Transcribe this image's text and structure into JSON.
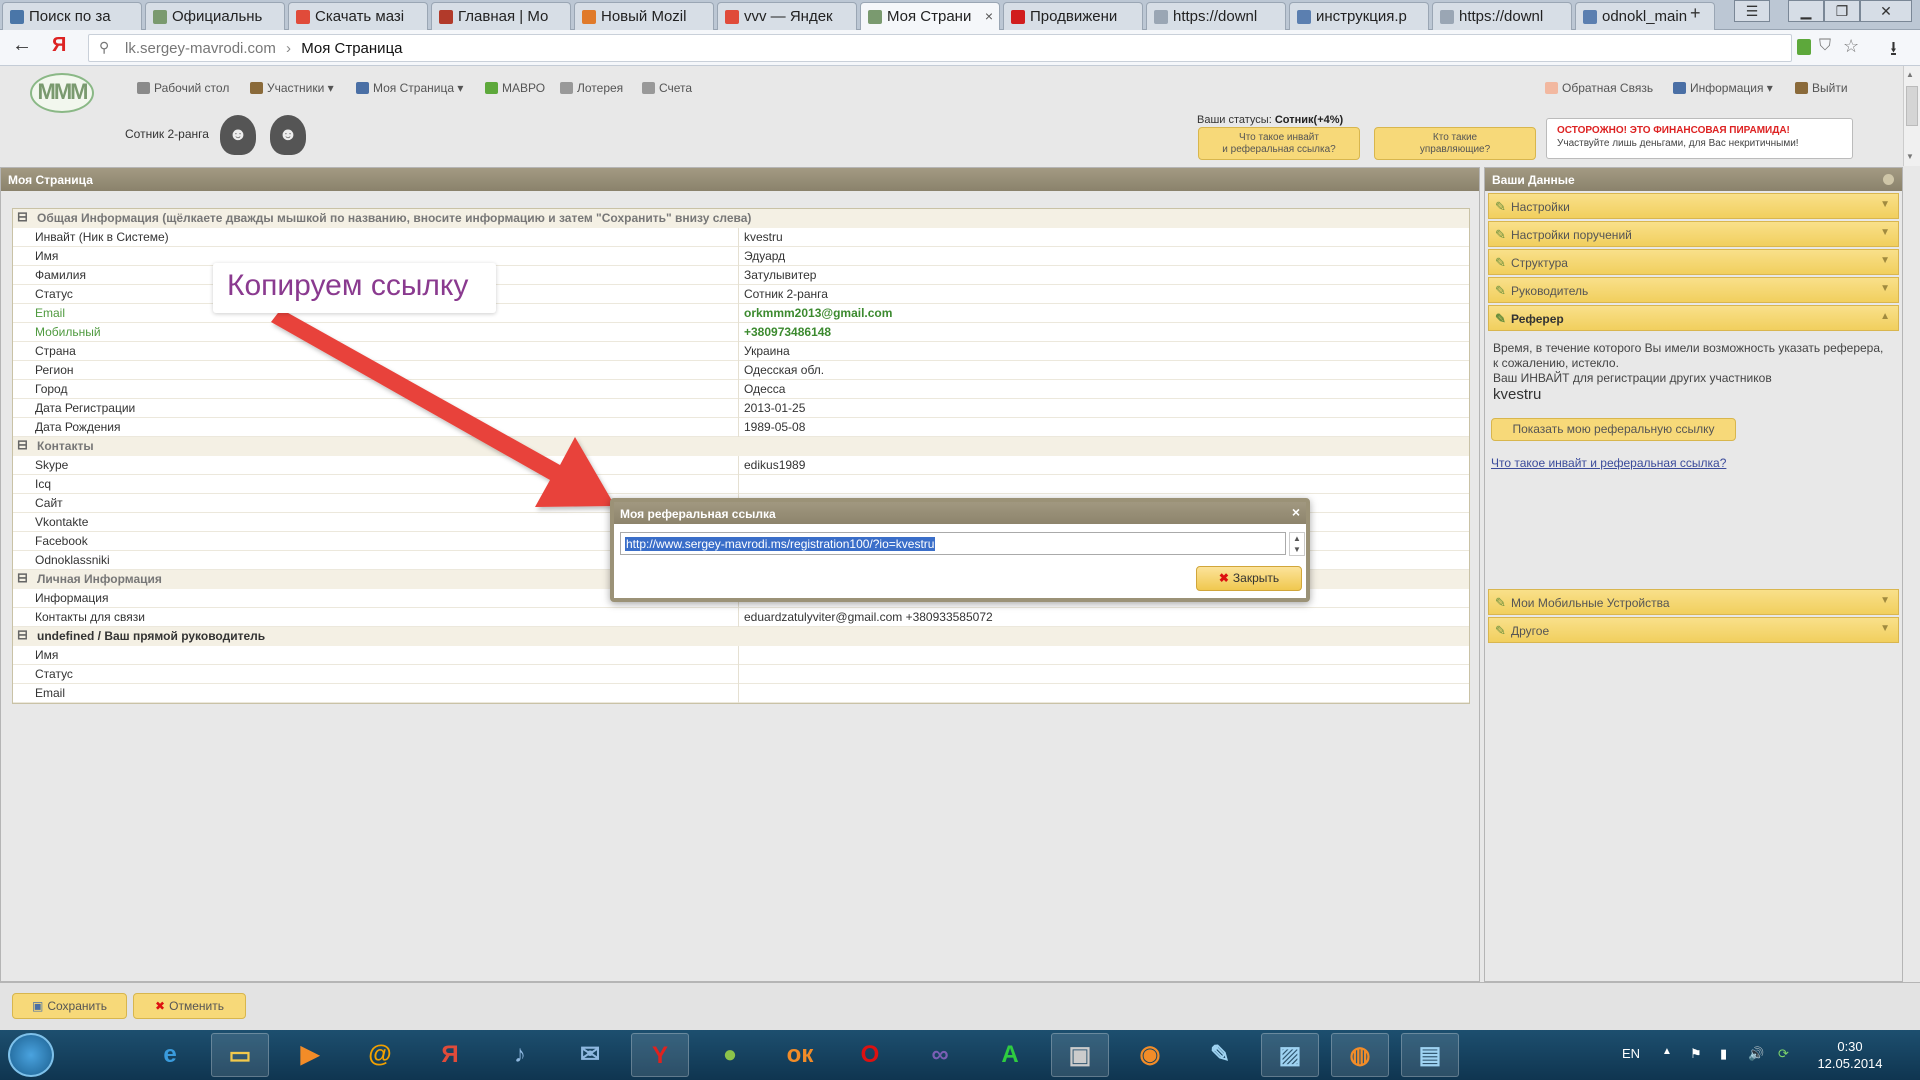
{
  "browser": {
    "tabs": [
      {
        "label": "Поиск по за",
        "color": "#4a76a8"
      },
      {
        "label": "Официальнь",
        "color": "#7a9a6f"
      },
      {
        "label": "Скачать мазі",
        "color": "#e04b3a"
      },
      {
        "label": "Главная | Мо",
        "color": "#b23a2a"
      },
      {
        "label": "Новый Mozil",
        "color": "#e07a2a"
      },
      {
        "label": "vvv — Яндек",
        "color": "#e04b3a"
      },
      {
        "label": "Моя Страни",
        "color": "#7a9a6f",
        "active": true
      },
      {
        "label": "Продвижени",
        "color": "#d11d1d"
      },
      {
        "label": "https://downl",
        "color": "#9aa6b4"
      },
      {
        "label": "инструкция.р",
        "color": "#5b7fb0"
      },
      {
        "label": "https://downl",
        "color": "#9aa6b4"
      },
      {
        "label": "odnokl_main",
        "color": "#5b7fb0"
      }
    ],
    "new_tab": "+",
    "yandex_logo": "Я",
    "url_domain": "lk.sergey-mavrodi.com",
    "url_sep": "›",
    "url_title": "Моя Страница",
    "accent": "#7a9a6f"
  },
  "site": {
    "logo": "MMM",
    "nav": [
      {
        "label": "Рабочий стол",
        "icon": "desktop-icon"
      },
      {
        "label": "Участники ▾",
        "icon": "users-icon"
      },
      {
        "label": "Моя Страница ▾",
        "icon": "user-icon"
      },
      {
        "label": "МАВРО",
        "icon": "mavro-icon"
      },
      {
        "label": "Лотерея",
        "icon": "lottery-icon"
      },
      {
        "label": "Счета",
        "icon": "accounts-icon"
      }
    ],
    "nav_right": [
      {
        "label": "Обратная Связь",
        "icon": "feedback-icon"
      },
      {
        "label": "Информация ▾",
        "icon": "info-icon"
      },
      {
        "label": "Выйти",
        "icon": "logout-icon"
      }
    ],
    "rank_label": "Сотник 2-ранга",
    "status_prefix": "Ваши статусы:",
    "status_value": "Сотник(+4%)",
    "btn_invite_line1": "Что такое инвайт",
    "btn_invite_line2": "и реферальная ссылка?",
    "btn_managers_line1": "Кто такие",
    "btn_managers_line2": "управляющие?",
    "warning_title": "ОСТОРОЖНО! ЭТО ФИНАНСОВАЯ ПИРАМИДА!",
    "warning_text": "Участвуйте лишь деньгами, для Вас некритичными!"
  },
  "main": {
    "title": "Моя Страница",
    "groups": [
      {
        "title": "Общая Информация (щёлкаете дважды мышкой по названию, вносите информацию и затем \"Сохранить\" внизу слева)",
        "toggle": "⊟",
        "rows": [
          {
            "label": "Инвайт (Ник в Системе)",
            "value": "kvestru"
          },
          {
            "label": "Имя",
            "value": "Эдуард"
          },
          {
            "label": "Фамилия",
            "value": "Затулывитер"
          },
          {
            "label": "Статус",
            "value": "Сотник 2-ранга"
          },
          {
            "label": "Email",
            "value": "orkmmm2013@gmail.com",
            "green": true
          },
          {
            "label": "Мобильный",
            "value": "+380973486148",
            "green": true
          },
          {
            "label": "Страна",
            "value": "Украина"
          },
          {
            "label": "Регион",
            "value": "Одесская обл."
          },
          {
            "label": "Город",
            "value": "Одесса"
          },
          {
            "label": "Дата Регистрации",
            "value": "2013-01-25"
          },
          {
            "label": "Дата Рождения",
            "value": "1989-05-08"
          }
        ]
      },
      {
        "title": "Контакты",
        "toggle": "⊟",
        "rows": [
          {
            "label": "Skype",
            "value": "edikus1989"
          },
          {
            "label": "Icq",
            "value": ""
          },
          {
            "label": "Сайт",
            "value": ""
          },
          {
            "label": "Vkontakte",
            "value": ""
          },
          {
            "label": "Facebook",
            "value": ""
          },
          {
            "label": "Odnoklassniki",
            "value": ""
          }
        ]
      },
      {
        "title": "Личная Информация",
        "toggle": "⊟",
        "rows": [
          {
            "label": "Информация",
            "value": ""
          },
          {
            "label": "Контакты для связи",
            "value": "eduardzatulyviter@gmail.com +380933585072"
          }
        ]
      },
      {
        "title": "undefined / Ваш прямой руководитель",
        "toggle": "⊟",
        "dark": true,
        "rows": [
          {
            "label": "Имя",
            "value": ""
          },
          {
            "label": "Статус",
            "value": ""
          },
          {
            "label": "Email",
            "value": ""
          }
        ]
      }
    ]
  },
  "right": {
    "title": "Ваши Данные",
    "items_top": [
      "Настройки",
      "Настройки поручений",
      "Структура",
      "Руководитель"
    ],
    "referrer_title": "Реферер",
    "referrer_text_1": "Время, в течение которого Вы имели возможность указать реферера,",
    "referrer_text_2": "к сожалению, истекло.",
    "referrer_text_3": "Ваш ИНВАЙТ для регистрации других участников",
    "referrer_nick": "kvestru",
    "show_link_btn": "Показать мою реферальную ссылку",
    "what_link": "Что такое инвайт и реферальная ссылка?",
    "items_bottom": [
      "Мои Мобильные Устройства",
      "Другое"
    ]
  },
  "modal": {
    "title": "Моя реферальная ссылка",
    "close_glyph": "×",
    "link": "http://www.sergey-mavrodi.ms/registration100/?io=kvestru",
    "close_btn": "Закрыть"
  },
  "annotation": {
    "caption": "Копируем ссылку",
    "arrow_color": "#e8423a"
  },
  "bottom": {
    "save": "Сохранить",
    "cancel": "Отменить"
  },
  "taskbar": {
    "apps": [
      {
        "name": "ie-icon",
        "glyph": "e",
        "color": "#3a9bdc"
      },
      {
        "name": "explorer-icon",
        "glyph": "▭",
        "color": "#f2c94c",
        "pinned": true
      },
      {
        "name": "media-player-icon",
        "glyph": "▶",
        "color": "#f28c28"
      },
      {
        "name": "mail-ru-agent-icon",
        "glyph": "@",
        "color": "#f2a100"
      },
      {
        "name": "yandex-icon",
        "glyph": "Я",
        "color": "#e04b3a"
      },
      {
        "name": "sound-icon",
        "glyph": "♪",
        "color": "#8fb8e0"
      },
      {
        "name": "mail-icon",
        "glyph": "✉",
        "color": "#8fb8e0"
      },
      {
        "name": "yandex-browser-icon",
        "glyph": "Y",
        "color": "#e0221e",
        "pinned": true
      },
      {
        "name": "ball-icon",
        "glyph": "●",
        "color": "#8bc34a"
      },
      {
        "name": "odnoklassniki-icon",
        "glyph": "ок",
        "color": "#f28c28"
      },
      {
        "name": "opera-icon",
        "glyph": "O",
        "color": "#d11"
      },
      {
        "name": "visual-studio-icon",
        "glyph": "∞",
        "color": "#7b5fb5"
      },
      {
        "name": "a-icon",
        "glyph": "A",
        "color": "#2ecc40"
      },
      {
        "name": "terminal-icon",
        "glyph": "▣",
        "color": "#ccc",
        "pinned": true
      },
      {
        "name": "origin-icon",
        "glyph": "◉",
        "color": "#f28c28"
      },
      {
        "name": "notepad-icon",
        "glyph": "✎",
        "color": "#9fd3f2"
      },
      {
        "name": "photos-icon",
        "glyph": "▨",
        "color": "#9fd3f2",
        "pinned": true
      },
      {
        "name": "firefox-icon",
        "glyph": "◍",
        "color": "#f28c28",
        "pinned": true
      },
      {
        "name": "monitor-icon",
        "glyph": "▤",
        "color": "#9fd3f2",
        "pinned": true
      }
    ],
    "lang": "EN",
    "time": "0:30",
    "date": "12.05.2014"
  }
}
